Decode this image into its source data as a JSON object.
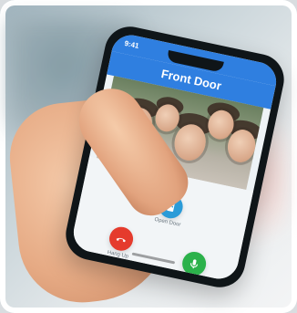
{
  "status_bar": {
    "time": "9:41"
  },
  "app": {
    "title": "Front Door"
  },
  "buttons": {
    "open_door": {
      "label": "Open Door",
      "icon": "door-icon"
    },
    "hang_up": {
      "label": "Hang Up",
      "icon": "phone-hangup-icon"
    },
    "mute": {
      "label": "Mute",
      "icon": "microphone-icon"
    }
  },
  "colors": {
    "header": "#2f7fe0",
    "open": "#2a9bd8",
    "hang": "#e53b2d",
    "mute": "#2bb14a"
  }
}
